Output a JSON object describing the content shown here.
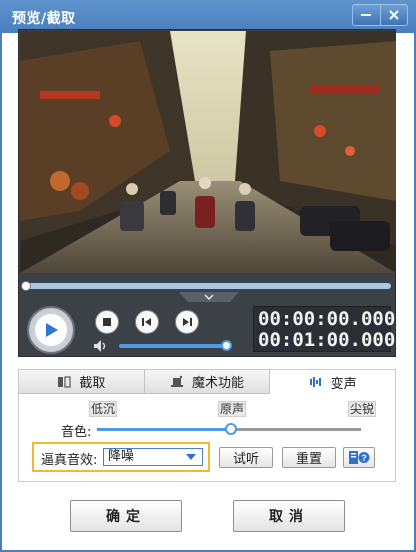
{
  "window": {
    "title": "预览/截取",
    "minimize_symbol": "—",
    "close_symbol": "✕"
  },
  "player": {
    "current_time": "00:00:00.000",
    "total_time": "00:01:00.000",
    "seek_progress": 0,
    "volume_level": 1.0
  },
  "tabs": [
    {
      "label": "截取",
      "icon": "crop-icon",
      "active": false
    },
    {
      "label": "魔术功能",
      "icon": "magic-hat-icon",
      "active": false
    },
    {
      "label": "变声",
      "icon": "soundwave-icon",
      "active": true
    }
  ],
  "voice": {
    "tone_low": "低沉",
    "tone_original": "原声",
    "tone_high": "尖锐",
    "tone_label": "音色:",
    "tone_level": 0.5,
    "effect_label": "逼真音效:",
    "effect_value": "降噪",
    "preview_button": "试听",
    "reset_button": "重置"
  },
  "footer": {
    "confirm": "确定",
    "cancel": "取消"
  },
  "colors": {
    "titlebar": "#4a7fbf",
    "accent": "#4d9be0",
    "highlight_border": "#f0b836",
    "player_bg": "#3c4148"
  }
}
